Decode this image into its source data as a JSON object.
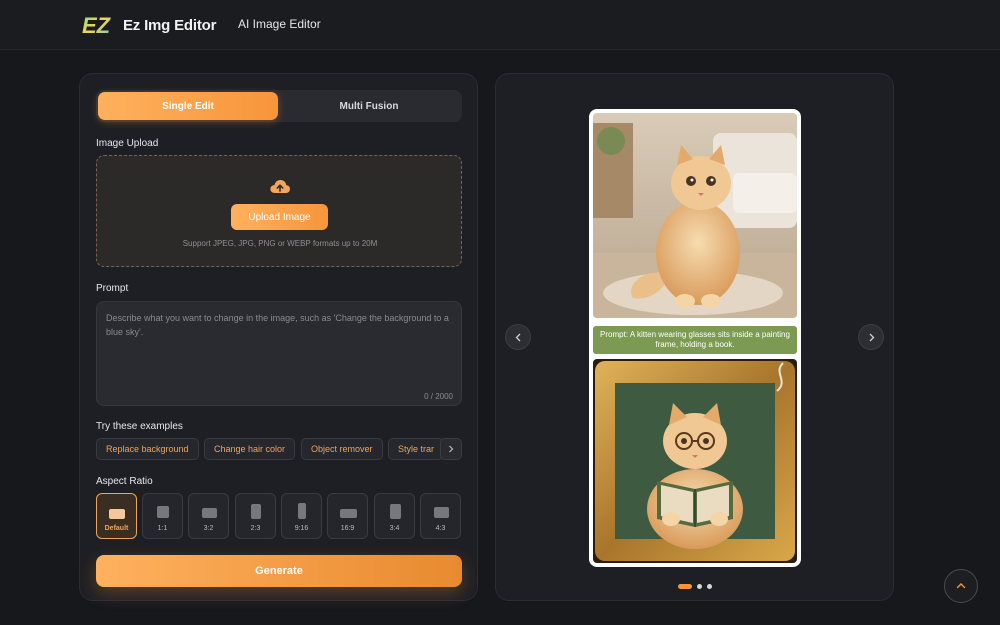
{
  "header": {
    "logo_text": "EZ",
    "brand": "Ez Img Editor",
    "nav_link": "AI Image Editor"
  },
  "editor": {
    "tabs": [
      "Single Edit",
      "Multi Fusion"
    ],
    "active_tab": "Single Edit",
    "upload_label": "Image Upload",
    "upload_button": "Upload Image",
    "upload_hint": "Support JPEG, JPG, PNG or WEBP formats up to 20M",
    "prompt_label": "Prompt",
    "prompt_placeholder": "Describe what you want to change in the image, such as 'Change the background to a blue sky'.",
    "prompt_value": "",
    "char_count": "0 / 2000",
    "examples_label": "Try these examples",
    "examples": [
      "Replace background",
      "Change hair color",
      "Object remover",
      "Style trar"
    ],
    "aspect_label": "Aspect Ratio",
    "aspect_ratios": [
      "Default",
      "1:1",
      "3:2",
      "2:3",
      "9:16",
      "16:9",
      "3:4",
      "4:3"
    ],
    "selected_aspect": "Default",
    "generate_button": "Generate"
  },
  "preview": {
    "caption": "Prompt: A kitten wearing glasses sits inside a painting frame, holding a book.",
    "slides_total": 3,
    "active_slide": 1
  },
  "colors": {
    "accent": "#f7953a",
    "accent_light": "#ffb15e",
    "background": "#17181c",
    "panel": "#1e1f24",
    "caption_bg": "#7c9a52"
  },
  "icons": {
    "upload": "cloud-upload-icon",
    "prev": "chevron-left-icon",
    "next": "chevron-right-icon",
    "chips_next": "chevron-right-icon",
    "scroll_top": "chevron-up-icon"
  }
}
